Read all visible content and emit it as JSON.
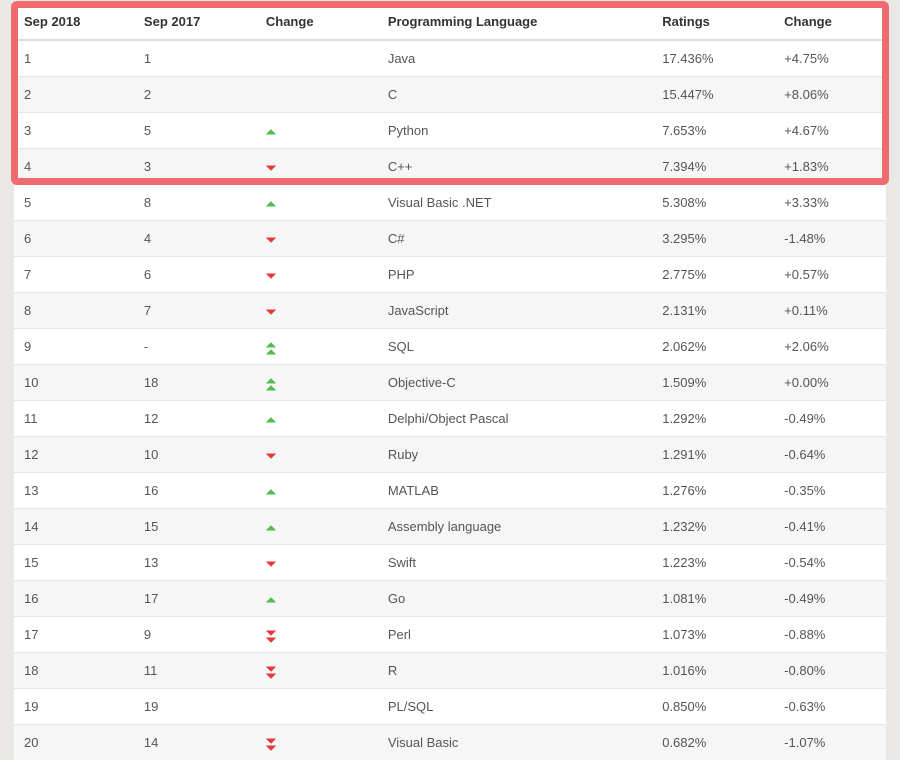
{
  "headers": {
    "sep2018": "Sep 2018",
    "sep2017": "Sep 2017",
    "change_dir": "Change",
    "language": "Programming Language",
    "ratings": "Ratings",
    "change_pct": "Change"
  },
  "rows": [
    {
      "r2018": "1",
      "r2017": "1",
      "dir": "",
      "lang": "Java",
      "rating": "17.436%",
      "delta": "+4.75%"
    },
    {
      "r2018": "2",
      "r2017": "2",
      "dir": "",
      "lang": "C",
      "rating": "15.447%",
      "delta": "+8.06%"
    },
    {
      "r2018": "3",
      "r2017": "5",
      "dir": "up",
      "lang": "Python",
      "rating": "7.653%",
      "delta": "+4.67%"
    },
    {
      "r2018": "4",
      "r2017": "3",
      "dir": "down",
      "lang": "C++",
      "rating": "7.394%",
      "delta": "+1.83%"
    },
    {
      "r2018": "5",
      "r2017": "8",
      "dir": "up",
      "lang": "Visual Basic .NET",
      "rating": "5.308%",
      "delta": "+3.33%"
    },
    {
      "r2018": "6",
      "r2017": "4",
      "dir": "down",
      "lang": "C#",
      "rating": "3.295%",
      "delta": "-1.48%"
    },
    {
      "r2018": "7",
      "r2017": "6",
      "dir": "down",
      "lang": "PHP",
      "rating": "2.775%",
      "delta": "+0.57%"
    },
    {
      "r2018": "8",
      "r2017": "7",
      "dir": "down",
      "lang": "JavaScript",
      "rating": "2.131%",
      "delta": "+0.11%"
    },
    {
      "r2018": "9",
      "r2017": "-",
      "dir": "up2",
      "lang": "SQL",
      "rating": "2.062%",
      "delta": "+2.06%"
    },
    {
      "r2018": "10",
      "r2017": "18",
      "dir": "up2",
      "lang": "Objective-C",
      "rating": "1.509%",
      "delta": "+0.00%"
    },
    {
      "r2018": "11",
      "r2017": "12",
      "dir": "up",
      "lang": "Delphi/Object Pascal",
      "rating": "1.292%",
      "delta": "-0.49%"
    },
    {
      "r2018": "12",
      "r2017": "10",
      "dir": "down",
      "lang": "Ruby",
      "rating": "1.291%",
      "delta": "-0.64%"
    },
    {
      "r2018": "13",
      "r2017": "16",
      "dir": "up",
      "lang": "MATLAB",
      "rating": "1.276%",
      "delta": "-0.35%"
    },
    {
      "r2018": "14",
      "r2017": "15",
      "dir": "up",
      "lang": "Assembly language",
      "rating": "1.232%",
      "delta": "-0.41%"
    },
    {
      "r2018": "15",
      "r2017": "13",
      "dir": "down",
      "lang": "Swift",
      "rating": "1.223%",
      "delta": "-0.54%"
    },
    {
      "r2018": "16",
      "r2017": "17",
      "dir": "up",
      "lang": "Go",
      "rating": "1.081%",
      "delta": "-0.49%"
    },
    {
      "r2018": "17",
      "r2017": "9",
      "dir": "down2",
      "lang": "Perl",
      "rating": "1.073%",
      "delta": "-0.88%"
    },
    {
      "r2018": "18",
      "r2017": "11",
      "dir": "down2",
      "lang": "R",
      "rating": "1.016%",
      "delta": "-0.80%"
    },
    {
      "r2018": "19",
      "r2017": "19",
      "dir": "",
      "lang": "PL/SQL",
      "rating": "0.850%",
      "delta": "-0.63%"
    },
    {
      "r2018": "20",
      "r2017": "14",
      "dir": "down2",
      "lang": "Visual Basic",
      "rating": "0.682%",
      "delta": "-1.07%"
    }
  ],
  "chart_data": {
    "type": "table",
    "title": "TIOBE Programming Community Index",
    "columns": [
      "Sep 2018",
      "Sep 2017",
      "Change",
      "Programming Language",
      "Ratings",
      "Change"
    ],
    "series": [
      {
        "name": "Java",
        "rank_2018": 1,
        "rank_2017": 1,
        "rating_pct": 17.436,
        "delta_pct": 4.75
      },
      {
        "name": "C",
        "rank_2018": 2,
        "rank_2017": 2,
        "rating_pct": 15.447,
        "delta_pct": 8.06
      },
      {
        "name": "Python",
        "rank_2018": 3,
        "rank_2017": 5,
        "rating_pct": 7.653,
        "delta_pct": 4.67
      },
      {
        "name": "C++",
        "rank_2018": 4,
        "rank_2017": 3,
        "rating_pct": 7.394,
        "delta_pct": 1.83
      },
      {
        "name": "Visual Basic .NET",
        "rank_2018": 5,
        "rank_2017": 8,
        "rating_pct": 5.308,
        "delta_pct": 3.33
      },
      {
        "name": "C#",
        "rank_2018": 6,
        "rank_2017": 4,
        "rating_pct": 3.295,
        "delta_pct": -1.48
      },
      {
        "name": "PHP",
        "rank_2018": 7,
        "rank_2017": 6,
        "rating_pct": 2.775,
        "delta_pct": 0.57
      },
      {
        "name": "JavaScript",
        "rank_2018": 8,
        "rank_2017": 7,
        "rating_pct": 2.131,
        "delta_pct": 0.11
      },
      {
        "name": "SQL",
        "rank_2018": 9,
        "rank_2017": null,
        "rating_pct": 2.062,
        "delta_pct": 2.06
      },
      {
        "name": "Objective-C",
        "rank_2018": 10,
        "rank_2017": 18,
        "rating_pct": 1.509,
        "delta_pct": 0.0
      },
      {
        "name": "Delphi/Object Pascal",
        "rank_2018": 11,
        "rank_2017": 12,
        "rating_pct": 1.292,
        "delta_pct": -0.49
      },
      {
        "name": "Ruby",
        "rank_2018": 12,
        "rank_2017": 10,
        "rating_pct": 1.291,
        "delta_pct": -0.64
      },
      {
        "name": "MATLAB",
        "rank_2018": 13,
        "rank_2017": 16,
        "rating_pct": 1.276,
        "delta_pct": -0.35
      },
      {
        "name": "Assembly language",
        "rank_2018": 14,
        "rank_2017": 15,
        "rating_pct": 1.232,
        "delta_pct": -0.41
      },
      {
        "name": "Swift",
        "rank_2018": 15,
        "rank_2017": 13,
        "rating_pct": 1.223,
        "delta_pct": -0.54
      },
      {
        "name": "Go",
        "rank_2018": 16,
        "rank_2017": 17,
        "rating_pct": 1.081,
        "delta_pct": -0.49
      },
      {
        "name": "Perl",
        "rank_2018": 17,
        "rank_2017": 9,
        "rating_pct": 1.073,
        "delta_pct": -0.88
      },
      {
        "name": "R",
        "rank_2018": 18,
        "rank_2017": 11,
        "rating_pct": 1.016,
        "delta_pct": -0.8
      },
      {
        "name": "PL/SQL",
        "rank_2018": 19,
        "rank_2017": 19,
        "rating_pct": 0.85,
        "delta_pct": -0.63
      },
      {
        "name": "Visual Basic",
        "rank_2018": 20,
        "rank_2017": 14,
        "rating_pct": 0.682,
        "delta_pct": -1.07
      }
    ]
  }
}
